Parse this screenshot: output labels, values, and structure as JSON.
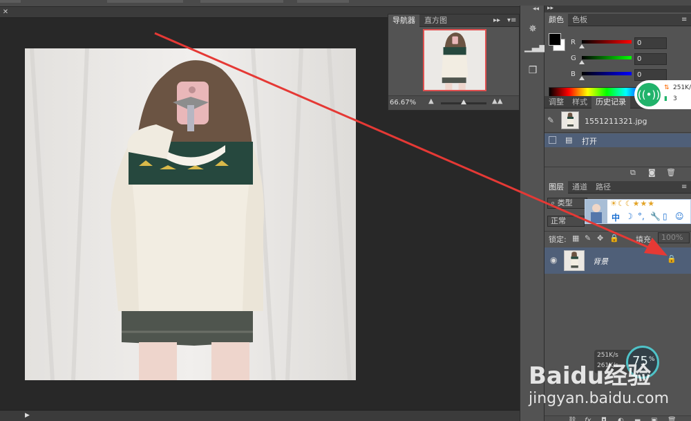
{
  "navigator": {
    "tabs": [
      "导航器",
      "直方图"
    ],
    "zoom": "66.67%"
  },
  "color_panel": {
    "tabs": [
      "颜色",
      "色板"
    ],
    "channels": [
      {
        "label": "R",
        "value": "0"
      },
      {
        "label": "G",
        "value": "0"
      },
      {
        "label": "B",
        "value": "0"
      }
    ]
  },
  "history_panel": {
    "tabs": [
      "调整",
      "样式",
      "历史记录"
    ],
    "snapshot_name": "1551211321.jpg",
    "states": [
      {
        "label": "打开"
      }
    ]
  },
  "layers_panel": {
    "tabs": [
      "图层",
      "通道",
      "路径"
    ],
    "filter_label": "类型",
    "blend_mode": "正常",
    "lock_label": "锁定:",
    "fill_label": "填充:",
    "fill_value": "100%",
    "layers": [
      {
        "name": "背景"
      }
    ]
  },
  "overlays": {
    "net_speed": "251K/s",
    "net_count": "3",
    "ime_label": "中",
    "cpu_percent": "75",
    "cpu_unit": "%",
    "speed2": "251K/s",
    "speed3": "261K/s",
    "watermark_brand": "Baidu经验",
    "watermark_url": "jingyan.baidu.com"
  },
  "annotation": {
    "color": "#e53935"
  },
  "colors": {
    "panel_bg": "#535353",
    "canvas_bg": "#282828",
    "highlight": "#4f5f78",
    "accent_green": "#21b36b"
  }
}
